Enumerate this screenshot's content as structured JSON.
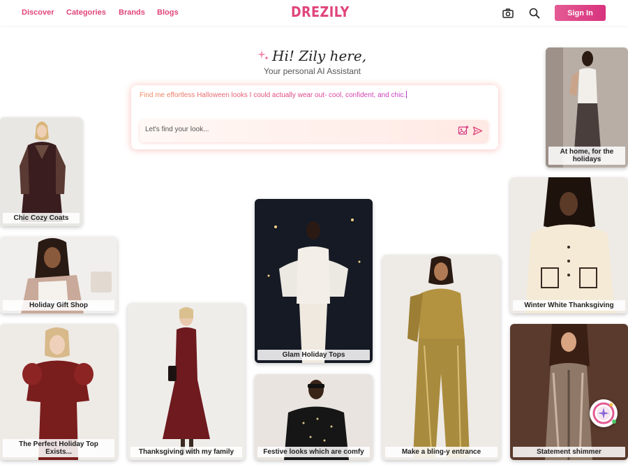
{
  "nav": {
    "links": [
      "Discover",
      "Categories",
      "Brands",
      "Blogs"
    ],
    "logo": "DREZILY",
    "camera_icon": "camera-icon",
    "search_icon": "search-icon",
    "signin_label": "Sign In"
  },
  "assistant": {
    "title": "Hi! Zily here,",
    "subtitle": "Your personal AI Assistant",
    "prompt_text": "Find me effortless Halloween looks I could actually wear out- cool, confident, and chic.",
    "input_placeholder": "Let's find your look...",
    "image_upload_icon": "image-upload-icon",
    "send_icon": "send-icon"
  },
  "cards": {
    "coats": "Chic Cozy Coats",
    "gift": "Holiday Gift Shop",
    "top_exists": "The Perfect Holiday Top Exists...",
    "thanksgiving": "Thanksgiving with my family",
    "glam": "Glam Holiday Tops",
    "festive": "Festive looks which are comfy",
    "bling": "Make a bling-y entrance",
    "home": "At home, for the holidays",
    "winter": "Winter White Thanksgiving",
    "shimmer": "Statement shimmer"
  },
  "colors": {
    "brand": "#e0457b",
    "signin_gradient": [
      "#e45b93",
      "#d8327e"
    ]
  }
}
